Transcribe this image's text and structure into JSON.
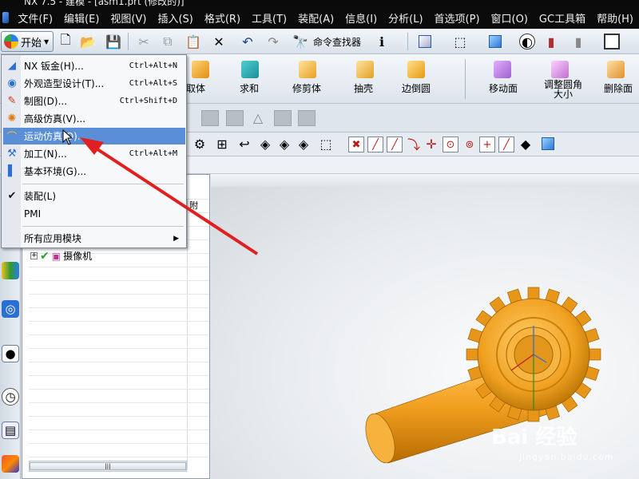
{
  "window": {
    "title": "NX 7.5 - 建模 - [asm1.prt (修改的)]"
  },
  "menubar": [
    "文件(F)",
    "编辑(E)",
    "视图(V)",
    "插入(S)",
    "格式(R)",
    "工具(T)",
    "装配(A)",
    "信息(I)",
    "分析(L)",
    "首选项(P)",
    "窗口(O)",
    "GC工具箱",
    "帮助(H)"
  ],
  "toolbar": {
    "start_label": "开始",
    "command_finder_label": "命令查找器"
  },
  "feature_toolbar": {
    "items": [
      "取体",
      "求和",
      "修剪体",
      "抽壳",
      "边倒圆"
    ],
    "sync_items": [
      "移动面",
      "调整圆角大小",
      "删除面"
    ]
  },
  "start_menu": {
    "items": [
      {
        "label": "NX 钣金(H)...",
        "shortcut": "Ctrl+Alt+N",
        "icon": "sheet-metal-icon"
      },
      {
        "label": "外观造型设计(T)...",
        "shortcut": "Ctrl+Alt+S",
        "icon": "shape-studio-icon"
      },
      {
        "label": "制图(D)...",
        "shortcut": "Ctrl+Shift+D",
        "icon": "drafting-icon"
      },
      {
        "label": "高级仿真(V)...",
        "shortcut": "",
        "icon": "advanced-simulation-icon"
      },
      {
        "label": "运动仿真(O)...",
        "shortcut": "",
        "icon": "motion-simulation-icon"
      },
      {
        "label": "加工(N)...",
        "shortcut": "Ctrl+Alt+M",
        "icon": "manufacturing-icon"
      },
      {
        "label": "基本环境(G)...",
        "shortcut": "",
        "icon": "gateway-icon"
      },
      {
        "label": "装配(L)",
        "shortcut": "",
        "icon": "check-icon"
      },
      {
        "label": "PMI",
        "shortcut": "",
        "icon": ""
      },
      {
        "label": "所有应用模块",
        "shortcut": "",
        "icon": ""
      }
    ]
  },
  "navigator": {
    "column_header": "附",
    "tree_item": "摄像机"
  },
  "watermark": {
    "text": "Bai 经验",
    "sub": "jingyan.baidu.com"
  },
  "colors": {
    "highlight": "#5a8fd8",
    "gear": "#f0a020",
    "arrow": "#e02020"
  }
}
